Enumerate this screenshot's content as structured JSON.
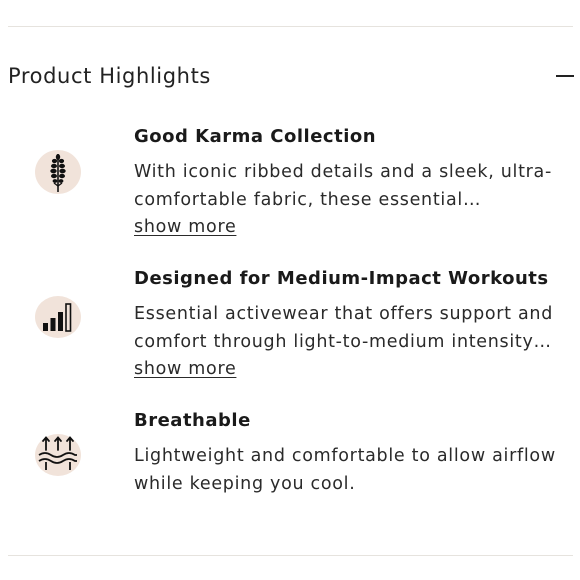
{
  "section": {
    "title": "Product Highlights",
    "toggle_icon": "minus-icon"
  },
  "highlights": [
    {
      "icon": "lavender-sprig-icon",
      "title": "Good Karma Collection",
      "lines": [
        "With iconic ribbed details and a sleek, ultra-",
        "comfortable fabric, these essential…"
      ],
      "link": "show more"
    },
    {
      "icon": "intensity-bars-icon",
      "title": "Designed for Medium-Impact Workouts",
      "lines": [
        "Essential activewear that offers support and",
        "comfort through light-to-medium intensity…"
      ],
      "link": "show more"
    },
    {
      "icon": "airflow-waves-icon",
      "title": "Breathable",
      "lines": [
        "Lightweight and comfortable to allow airflow",
        "while keeping you cool."
      ]
    }
  ],
  "colors": {
    "icon_blob": "#f1e3da",
    "icon_stroke": "#111111",
    "divider": "#e6e3de"
  }
}
